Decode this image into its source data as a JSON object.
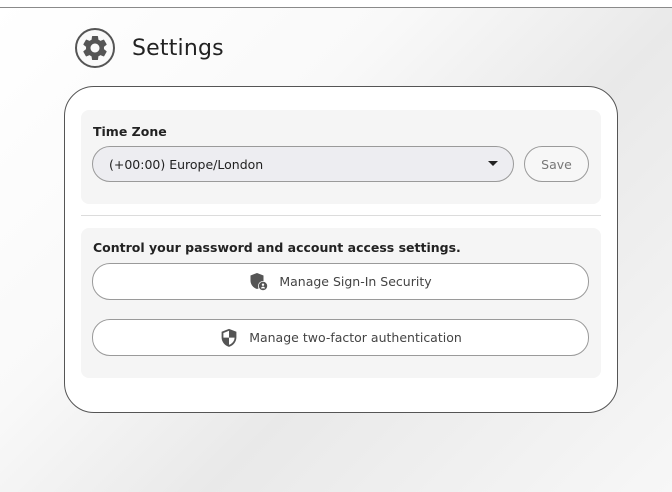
{
  "header": {
    "title": "Settings",
    "icon": "gear-icon"
  },
  "timezone": {
    "label": "Time Zone",
    "selected": "(+00:00) Europe/London",
    "save_label": "Save"
  },
  "security": {
    "description": "Control your password and account access settings.",
    "sign_in_label": "Manage Sign-In Security",
    "sign_in_icon": "shield-lock-icon",
    "two_factor_label": "Manage two-factor authentication",
    "two_factor_icon": "shield-icon"
  },
  "colors": {
    "icon": "#555555",
    "border": "#9a9a9a",
    "section_bg": "#f5f5f5"
  }
}
